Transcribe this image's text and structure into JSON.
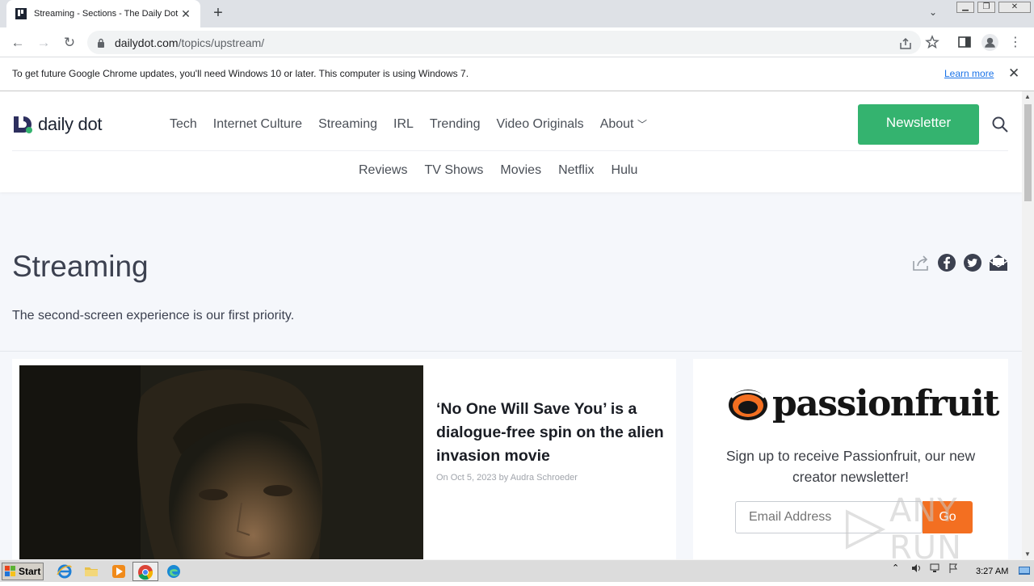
{
  "browser": {
    "tab_title": "Streaming - Sections - The Daily Dot",
    "new_tab_symbol": "+",
    "url_host": "dailydot.com",
    "url_path": "/topics/upstream/"
  },
  "infobar": {
    "message": "To get future Google Chrome updates, you'll need Windows 10 or later. This computer is using Windows 7.",
    "link": "Learn more"
  },
  "site": {
    "logo_text": "daily dot",
    "nav": [
      "Tech",
      "Internet Culture",
      "Streaming",
      "IRL",
      "Trending",
      "Video Originals",
      "About"
    ],
    "newsletter_label": "Newsletter",
    "subnav": [
      "Reviews",
      "TV Shows",
      "Movies",
      "Netflix",
      "Hulu"
    ]
  },
  "section": {
    "title": "Streaming",
    "description": "The second-screen experience is our first priority."
  },
  "article": {
    "title": "‘No One Will Save You’ is a dialogue-free spin on the alien invasion movie",
    "meta": "On Oct 5, 2023 by Audra Schroeder"
  },
  "promo": {
    "brand": "passionfruit",
    "description": "Sign up to receive Passionfruit, our new creator newsletter!",
    "email_placeholder": "Email Address",
    "go_label": "Go"
  },
  "watermark": "ANY RUN",
  "taskbar": {
    "start_label": "Start",
    "clock": "3:27 AM"
  },
  "colors": {
    "newsletter_green": "#34b36f",
    "go_orange": "#f36f21",
    "page_bg": "#f5f7fb"
  }
}
